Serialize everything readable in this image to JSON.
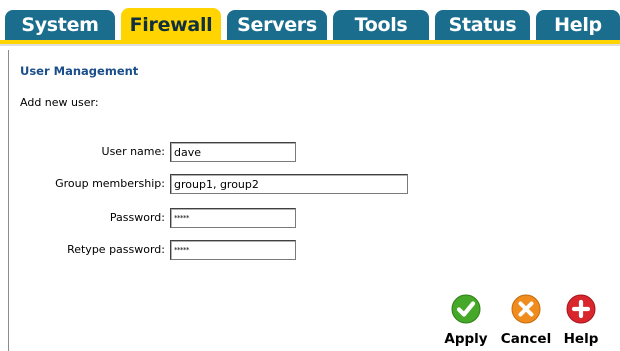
{
  "nav": {
    "tabs": [
      {
        "label": "System",
        "active": false
      },
      {
        "label": "Firewall",
        "active": true
      },
      {
        "label": "Servers",
        "active": false
      },
      {
        "label": "Tools",
        "active": false
      },
      {
        "label": "Status",
        "active": false
      },
      {
        "label": "Help",
        "active": false
      }
    ],
    "colors": {
      "tab": "#1b6d8e",
      "active_tab": "#ffd400"
    }
  },
  "page": {
    "title": "User Management",
    "subheading": "Add new user:"
  },
  "form": {
    "username": {
      "label": "User name:",
      "value": "dave"
    },
    "groups": {
      "label": "Group membership:",
      "value": "group1, group2"
    },
    "password": {
      "label": "Password:",
      "value": "*****"
    },
    "retype_password": {
      "label": "Retype password:",
      "value": "*****"
    }
  },
  "actions": {
    "apply": {
      "label": "Apply",
      "icon": "checkmark-icon",
      "color": "#46a829"
    },
    "cancel": {
      "label": "Cancel",
      "icon": "cross-icon",
      "color": "#ef8c1d"
    },
    "help": {
      "label": "Help",
      "icon": "plus-icon",
      "color": "#d8262c"
    }
  }
}
